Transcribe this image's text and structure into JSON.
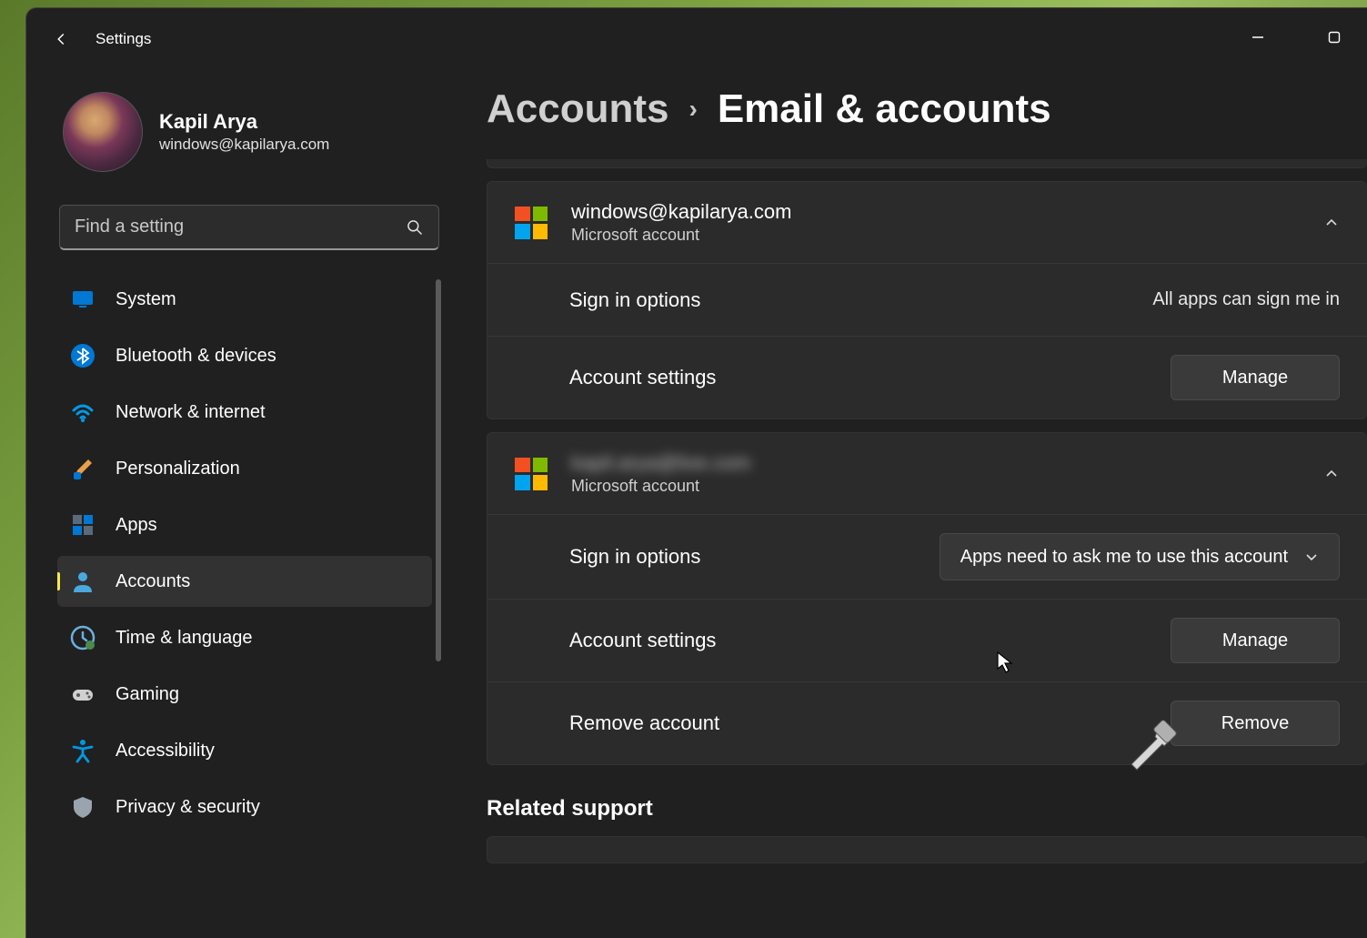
{
  "window": {
    "title": "Settings"
  },
  "profile": {
    "name": "Kapil Arya",
    "email": "windows@kapilarya.com"
  },
  "search": {
    "placeholder": "Find a setting"
  },
  "nav": [
    {
      "id": "system",
      "label": "System",
      "icon": "monitor",
      "active": false
    },
    {
      "id": "bluetooth",
      "label": "Bluetooth & devices",
      "icon": "bluetooth",
      "active": false
    },
    {
      "id": "network",
      "label": "Network & internet",
      "icon": "wifi",
      "active": false
    },
    {
      "id": "personalization",
      "label": "Personalization",
      "icon": "brush",
      "active": false
    },
    {
      "id": "apps",
      "label": "Apps",
      "icon": "apps",
      "active": false
    },
    {
      "id": "accounts",
      "label": "Accounts",
      "icon": "person",
      "active": true
    },
    {
      "id": "time",
      "label": "Time & language",
      "icon": "clock",
      "active": false
    },
    {
      "id": "gaming",
      "label": "Gaming",
      "icon": "gamepad",
      "active": false
    },
    {
      "id": "accessibility",
      "label": "Accessibility",
      "icon": "accessibility",
      "active": false
    },
    {
      "id": "privacy",
      "label": "Privacy & security",
      "icon": "shield",
      "active": false
    }
  ],
  "breadcrumb": {
    "parent": "Accounts",
    "current": "Email & accounts"
  },
  "accounts": [
    {
      "email": "windows@kapilarya.com",
      "type": "Microsoft account",
      "blurred": false,
      "rows": [
        {
          "kind": "signin",
          "label": "Sign in options",
          "value": "All apps can sign me in"
        },
        {
          "kind": "settings",
          "label": "Account settings",
          "button": "Manage"
        }
      ]
    },
    {
      "email": "kapil.arya@live.com",
      "type": "Microsoft account",
      "blurred": true,
      "rows": [
        {
          "kind": "signin-dd",
          "label": "Sign in options",
          "dropdown": "Apps need to ask me to use this account"
        },
        {
          "kind": "settings",
          "label": "Account settings",
          "button": "Manage"
        },
        {
          "kind": "remove",
          "label": "Remove account",
          "button": "Remove"
        }
      ]
    }
  ],
  "related": {
    "title": "Related support"
  }
}
